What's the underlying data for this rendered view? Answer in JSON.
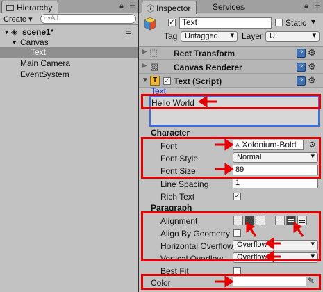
{
  "hierarchy": {
    "tab_label": "Hierarchy",
    "create_label": "Create ▾",
    "search_placeholder": "All",
    "scene": "scene1*",
    "items": [
      {
        "label": "Canvas"
      },
      {
        "label": "Text"
      },
      {
        "label": "Main Camera"
      },
      {
        "label": "EventSystem"
      }
    ]
  },
  "inspector": {
    "tab_label": "Inspector",
    "services_tab": "Services",
    "object_name": "Text",
    "static_label": "Static",
    "tag_label": "Tag",
    "tag_value": "Untagged",
    "layer_label": "Layer",
    "layer_value": "UI",
    "components": {
      "rect_transform": "Rect Transform",
      "canvas_renderer": "Canvas Renderer",
      "text_script": "Text (Script)"
    },
    "text_section_label": "Text",
    "text_value": "Hello World",
    "character": {
      "header": "Character",
      "font_label": "Font",
      "font_value": "Xolonium-Bold",
      "font_style_label": "Font Style",
      "font_style_value": "Normal",
      "font_size_label": "Font Size",
      "font_size_value": "89",
      "line_spacing_label": "Line Spacing",
      "line_spacing_value": "1",
      "rich_text_label": "Rich Text"
    },
    "paragraph": {
      "header": "Paragraph",
      "alignment_label": "Alignment",
      "align_by_geometry_label": "Align By Geometry",
      "horizontal_overflow_label": "Horizontal Overflow",
      "horizontal_overflow_value": "Overflow",
      "vertical_overflow_label": "Vertical Overflow",
      "vertical_overflow_value": "Overflow",
      "best_fit_label": "Best Fit"
    },
    "color_label": "Color"
  },
  "colors": {
    "highlight": "#e60000",
    "panel": "#c2c2c2",
    "selected_row": "#8f8f8f",
    "link_blue": "#1a3ecf"
  }
}
